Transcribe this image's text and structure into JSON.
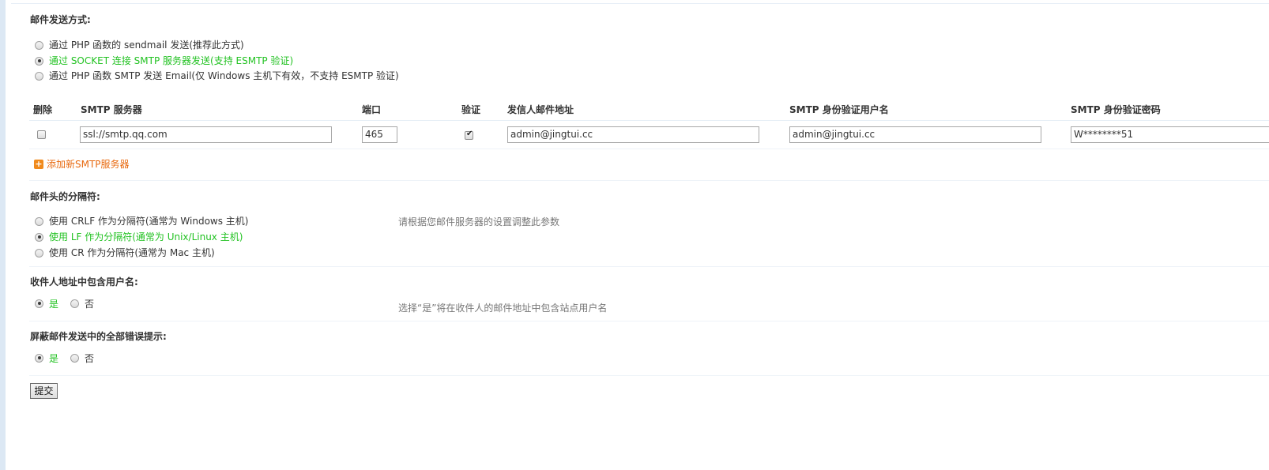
{
  "mail_send_method": {
    "title": "邮件发送方式:",
    "options": [
      {
        "label": "通过 PHP 函数的 sendmail 发送(推荐此方式)",
        "checked": false
      },
      {
        "label": "通过 SOCKET 连接 SMTP 服务器发送(支持 ESMTP 验证)",
        "checked": true
      },
      {
        "label": "通过 PHP 函数 SMTP 发送 Email(仅 Windows 主机下有效，不支持 ESMTP 验证)",
        "checked": false
      }
    ]
  },
  "smtp_table": {
    "headers": {
      "delete": "删除",
      "server": "SMTP 服务器",
      "port": "端口",
      "auth": "验证",
      "from": "发信人邮件地址",
      "username": "SMTP 身份验证用户名",
      "password": "SMTP 身份验证密码"
    },
    "rows": [
      {
        "delete_checked": false,
        "server": "ssl://smtp.qq.com",
        "port": "465",
        "auth_checked": true,
        "from": "admin@jingtui.cc",
        "username": "admin@jingtui.cc",
        "password": "W********51"
      }
    ],
    "add_label": "添加新SMTP服务器",
    "add_icon": "plus-square-icon"
  },
  "header_separator": {
    "title": "邮件头的分隔符:",
    "hint": "请根据您邮件服务器的设置调整此参数",
    "options": [
      {
        "label": "使用 CRLF 作为分隔符(通常为 Windows 主机)",
        "checked": false
      },
      {
        "label": "使用 LF 作为分隔符(通常为 Unix/Linux 主机)",
        "checked": true
      },
      {
        "label": "使用 CR 作为分隔符(通常为 Mac 主机)",
        "checked": false
      }
    ]
  },
  "include_username": {
    "title": "收件人地址中包含用户名:",
    "hint": "选择“是”将在收件人的邮件地址中包含站点用户名",
    "yes": "是",
    "no": "否",
    "value": "yes"
  },
  "silence_errors": {
    "title": "屏蔽邮件发送中的全部错误提示:",
    "yes": "是",
    "no": "否",
    "value": "yes"
  },
  "submit_label": "提交",
  "colors": {
    "selected_text": "#22c222",
    "link_orange": "#e86a10",
    "frame_border": "#dce8f4"
  }
}
